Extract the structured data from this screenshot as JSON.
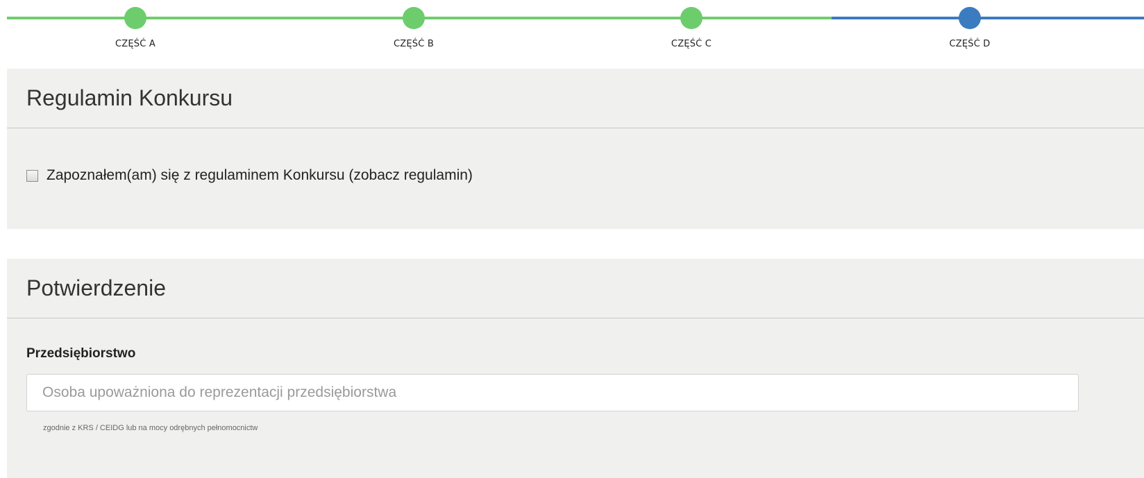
{
  "stepper": {
    "steps": [
      {
        "label": "CZĘŚĆ A",
        "status": "completed"
      },
      {
        "label": "CZĘŚĆ B",
        "status": "completed"
      },
      {
        "label": "CZĘŚĆ C",
        "status": "completed"
      },
      {
        "label": "CZĘŚĆ D",
        "status": "current"
      }
    ],
    "colors": {
      "completed": "#6dcd6d",
      "current": "#3b7bbf"
    }
  },
  "regulamin": {
    "title": "Regulamin Konkursu",
    "checkbox_label": "Zapoznałem(am) się z regulaminem Konkursu (zobacz regulamin)",
    "checked": false
  },
  "potwierdzenie": {
    "title": "Potwierdzenie",
    "field_label": "Przedsiębiorstwo",
    "input_value": "",
    "input_placeholder": "Osoba upoważniona do reprezentacji przedsiębiorstwa",
    "help_text": "zgodnie z KRS / CEIDG lub na mocy odrębnych pełnomocnictw"
  }
}
